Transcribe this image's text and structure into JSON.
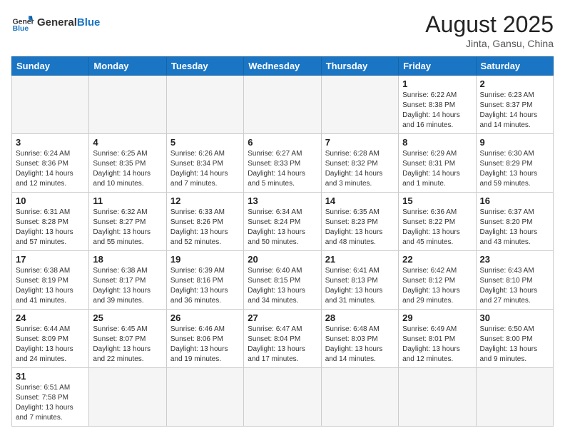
{
  "header": {
    "logo_general": "General",
    "logo_blue": "Blue",
    "month_title": "August 2025",
    "subtitle": "Jinta, Gansu, China"
  },
  "weekdays": [
    "Sunday",
    "Monday",
    "Tuesday",
    "Wednesday",
    "Thursday",
    "Friday",
    "Saturday"
  ],
  "days": [
    {
      "date": "",
      "info": ""
    },
    {
      "date": "",
      "info": ""
    },
    {
      "date": "",
      "info": ""
    },
    {
      "date": "",
      "info": ""
    },
    {
      "date": "",
      "info": ""
    },
    {
      "date": "1",
      "info": "Sunrise: 6:22 AM\nSunset: 8:38 PM\nDaylight: 14 hours and 16 minutes."
    },
    {
      "date": "2",
      "info": "Sunrise: 6:23 AM\nSunset: 8:37 PM\nDaylight: 14 hours and 14 minutes."
    },
    {
      "date": "3",
      "info": "Sunrise: 6:24 AM\nSunset: 8:36 PM\nDaylight: 14 hours and 12 minutes."
    },
    {
      "date": "4",
      "info": "Sunrise: 6:25 AM\nSunset: 8:35 PM\nDaylight: 14 hours and 10 minutes."
    },
    {
      "date": "5",
      "info": "Sunrise: 6:26 AM\nSunset: 8:34 PM\nDaylight: 14 hours and 7 minutes."
    },
    {
      "date": "6",
      "info": "Sunrise: 6:27 AM\nSunset: 8:33 PM\nDaylight: 14 hours and 5 minutes."
    },
    {
      "date": "7",
      "info": "Sunrise: 6:28 AM\nSunset: 8:32 PM\nDaylight: 14 hours and 3 minutes."
    },
    {
      "date": "8",
      "info": "Sunrise: 6:29 AM\nSunset: 8:31 PM\nDaylight: 14 hours and 1 minute."
    },
    {
      "date": "9",
      "info": "Sunrise: 6:30 AM\nSunset: 8:29 PM\nDaylight: 13 hours and 59 minutes."
    },
    {
      "date": "10",
      "info": "Sunrise: 6:31 AM\nSunset: 8:28 PM\nDaylight: 13 hours and 57 minutes."
    },
    {
      "date": "11",
      "info": "Sunrise: 6:32 AM\nSunset: 8:27 PM\nDaylight: 13 hours and 55 minutes."
    },
    {
      "date": "12",
      "info": "Sunrise: 6:33 AM\nSunset: 8:26 PM\nDaylight: 13 hours and 52 minutes."
    },
    {
      "date": "13",
      "info": "Sunrise: 6:34 AM\nSunset: 8:24 PM\nDaylight: 13 hours and 50 minutes."
    },
    {
      "date": "14",
      "info": "Sunrise: 6:35 AM\nSunset: 8:23 PM\nDaylight: 13 hours and 48 minutes."
    },
    {
      "date": "15",
      "info": "Sunrise: 6:36 AM\nSunset: 8:22 PM\nDaylight: 13 hours and 45 minutes."
    },
    {
      "date": "16",
      "info": "Sunrise: 6:37 AM\nSunset: 8:20 PM\nDaylight: 13 hours and 43 minutes."
    },
    {
      "date": "17",
      "info": "Sunrise: 6:38 AM\nSunset: 8:19 PM\nDaylight: 13 hours and 41 minutes."
    },
    {
      "date": "18",
      "info": "Sunrise: 6:38 AM\nSunset: 8:17 PM\nDaylight: 13 hours and 39 minutes."
    },
    {
      "date": "19",
      "info": "Sunrise: 6:39 AM\nSunset: 8:16 PM\nDaylight: 13 hours and 36 minutes."
    },
    {
      "date": "20",
      "info": "Sunrise: 6:40 AM\nSunset: 8:15 PM\nDaylight: 13 hours and 34 minutes."
    },
    {
      "date": "21",
      "info": "Sunrise: 6:41 AM\nSunset: 8:13 PM\nDaylight: 13 hours and 31 minutes."
    },
    {
      "date": "22",
      "info": "Sunrise: 6:42 AM\nSunset: 8:12 PM\nDaylight: 13 hours and 29 minutes."
    },
    {
      "date": "23",
      "info": "Sunrise: 6:43 AM\nSunset: 8:10 PM\nDaylight: 13 hours and 27 minutes."
    },
    {
      "date": "24",
      "info": "Sunrise: 6:44 AM\nSunset: 8:09 PM\nDaylight: 13 hours and 24 minutes."
    },
    {
      "date": "25",
      "info": "Sunrise: 6:45 AM\nSunset: 8:07 PM\nDaylight: 13 hours and 22 minutes."
    },
    {
      "date": "26",
      "info": "Sunrise: 6:46 AM\nSunset: 8:06 PM\nDaylight: 13 hours and 19 minutes."
    },
    {
      "date": "27",
      "info": "Sunrise: 6:47 AM\nSunset: 8:04 PM\nDaylight: 13 hours and 17 minutes."
    },
    {
      "date": "28",
      "info": "Sunrise: 6:48 AM\nSunset: 8:03 PM\nDaylight: 13 hours and 14 minutes."
    },
    {
      "date": "29",
      "info": "Sunrise: 6:49 AM\nSunset: 8:01 PM\nDaylight: 13 hours and 12 minutes."
    },
    {
      "date": "30",
      "info": "Sunrise: 6:50 AM\nSunset: 8:00 PM\nDaylight: 13 hours and 9 minutes."
    },
    {
      "date": "31",
      "info": "Sunrise: 6:51 AM\nSunset: 7:58 PM\nDaylight: 13 hours and 7 minutes."
    },
    {
      "date": "",
      "info": ""
    },
    {
      "date": "",
      "info": ""
    },
    {
      "date": "",
      "info": ""
    },
    {
      "date": "",
      "info": ""
    },
    {
      "date": "",
      "info": ""
    },
    {
      "date": "",
      "info": ""
    }
  ]
}
